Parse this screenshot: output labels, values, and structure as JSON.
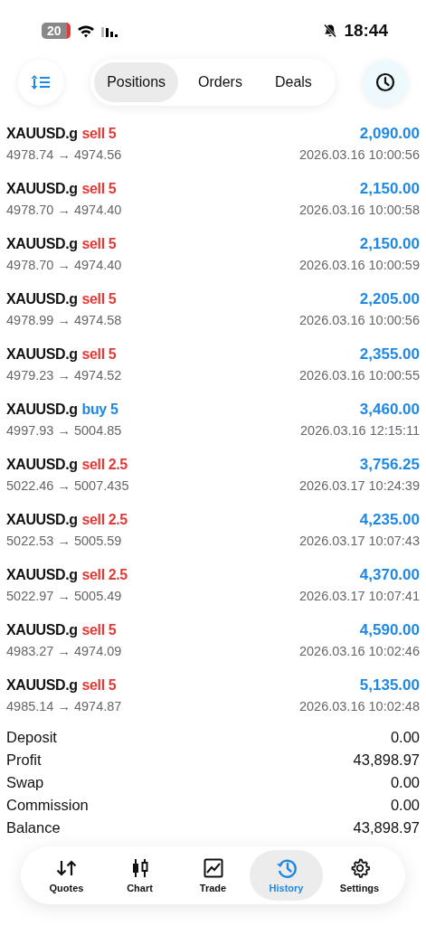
{
  "status_bar": {
    "battery": "20",
    "time": "18:44"
  },
  "toolbar": {
    "tabs": [
      {
        "label": "Positions",
        "selected": true
      },
      {
        "label": "Orders",
        "selected": false
      },
      {
        "label": "Deals",
        "selected": false
      }
    ]
  },
  "deals": [
    {
      "symbol": "XAUUSD.g",
      "side": "sell 5",
      "kind": "sell",
      "profit": "2,090.00",
      "prices": "4978.74 → 4974.56",
      "time": "2026.03.16 10:00:56",
      "faded": false
    },
    {
      "symbol": "XAUUSD.g",
      "side": "sell 5",
      "kind": "sell",
      "profit": "2,150.00",
      "prices": "4978.70 → 4974.40",
      "time": "2026.03.16 10:00:58",
      "faded": false
    },
    {
      "symbol": "XAUUSD.g",
      "side": "sell 5",
      "kind": "sell",
      "profit": "2,150.00",
      "prices": "4978.70 → 4974.40",
      "time": "2026.03.16 10:00:59",
      "faded": false
    },
    {
      "symbol": "XAUUSD.g",
      "side": "sell 5",
      "kind": "sell",
      "profit": "2,205.00",
      "prices": "4978.99 → 4974.58",
      "time": "2026.03.16 10:00:56",
      "faded": false
    },
    {
      "symbol": "XAUUSD.g",
      "side": "sell 5",
      "kind": "sell",
      "profit": "2,355.00",
      "prices": "4979.23 → 4974.52",
      "time": "2026.03.16 10:00:55",
      "faded": false
    },
    {
      "symbol": "XAUUSD.g",
      "side": "buy 5",
      "kind": "buy",
      "profit": "3,460.00",
      "prices": "4997.93 → 5004.85",
      "time": "2026.03.16 12:15:11",
      "faded": false
    },
    {
      "symbol": "XAUUSD.g",
      "side": "sell 2.5",
      "kind": "sell",
      "profit": "3,756.25",
      "prices": "5022.46 → 5007.435",
      "time": "2026.03.17 10:24:39",
      "faded": false
    },
    {
      "symbol": "XAUUSD.g",
      "side": "sell 2.5",
      "kind": "sell",
      "profit": "4,235.00",
      "prices": "5022.53 → 5005.59",
      "time": "2026.03.17 10:07:43",
      "faded": false
    },
    {
      "symbol": "XAUUSD.g",
      "side": "sell 2.5",
      "kind": "sell",
      "profit": "4,370.00",
      "prices": "5022.97 → 5005.49",
      "time": "2026.03.17 10:07:41",
      "faded": false
    },
    {
      "symbol": "XAUUSD.g",
      "side": "sell 5",
      "kind": "sell",
      "profit": "4,590.00",
      "prices": "4983.27 → 4974.09",
      "time": "2026.03.16 10:02:46",
      "faded": false
    },
    {
      "symbol": "XAUUSD.g",
      "side": "sell 5",
      "kind": "sell",
      "profit": "5,135.00",
      "prices": "4985.14 → 4974.87",
      "time": "2026.03.16 10:02:48",
      "faded": false
    }
  ],
  "summary": [
    {
      "label": "Deposit",
      "value": "0.00"
    },
    {
      "label": "Profit",
      "value": "43,898.97"
    },
    {
      "label": "Swap",
      "value": "0.00"
    },
    {
      "label": "Commission",
      "value": "0.00"
    },
    {
      "label": "Balance",
      "value": "43,898.97"
    }
  ],
  "nav": [
    {
      "label": "Quotes",
      "selected": false
    },
    {
      "label": "Chart",
      "selected": false
    },
    {
      "label": "Trade",
      "selected": false
    },
    {
      "label": "History",
      "selected": true
    },
    {
      "label": "Settings",
      "selected": false
    }
  ]
}
